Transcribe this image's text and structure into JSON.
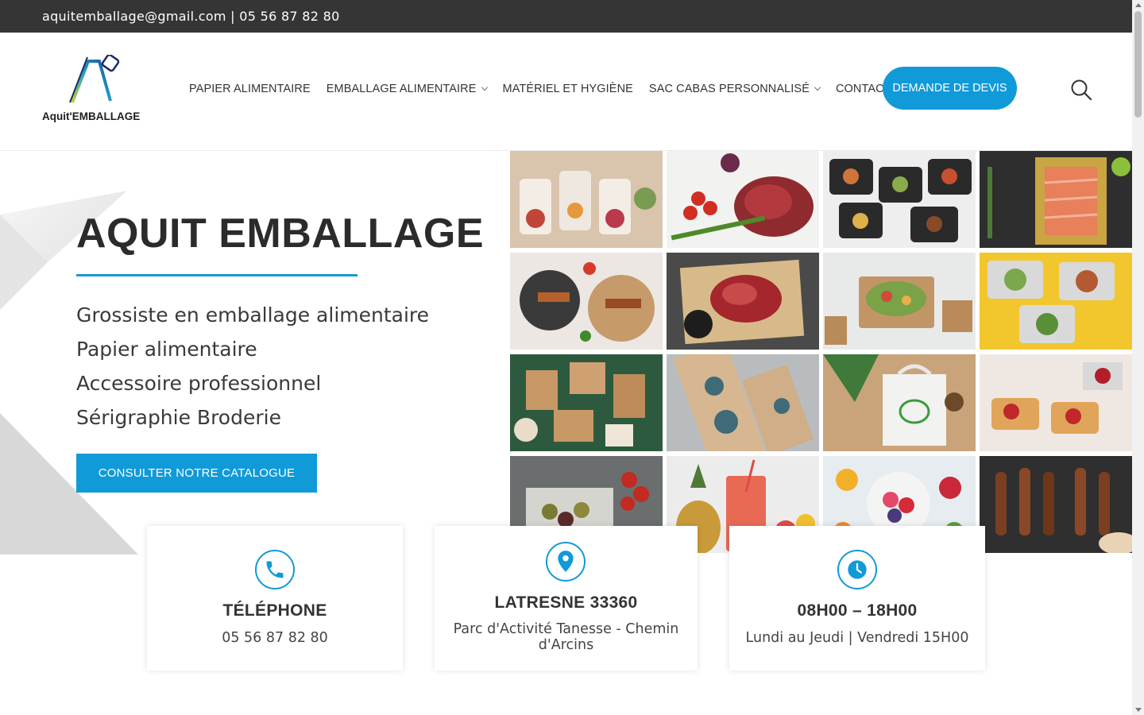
{
  "topbar": {
    "contact": "aquitemballage@gmail.com | 05 56 87 82 80"
  },
  "brand": {
    "logo_text": "Aquit'EMBALLAGE",
    "accent": "#109ad8",
    "topbar_bg": "#353535"
  },
  "nav": {
    "items": [
      {
        "label": "PAPIER ALIMENTAIRE",
        "has_dropdown": false
      },
      {
        "label": "EMBALLAGE ALIMENTAIRE",
        "has_dropdown": true
      },
      {
        "label": "MATÉRIEL ET HYGIÈNE",
        "has_dropdown": false
      },
      {
        "label": "SAC CABAS PERSONNALISÉ",
        "has_dropdown": true
      },
      {
        "label": "CONTACT",
        "has_dropdown": false
      }
    ],
    "cta": "DEMANDE DE DEVIS",
    "search_icon": "search-icon"
  },
  "hero": {
    "title": "AQUIT EMBALLAGE",
    "lines": [
      "Grossiste en emballage alimentaire",
      "Papier alimentaire",
      "Accessoire professionnel",
      "Sérigraphie Broderie"
    ],
    "button": "CONSULTER NOTRE CATALOGUE"
  },
  "cards": [
    {
      "icon": "phone-icon",
      "title": "TÉLÉPHONE",
      "text": "05 56 87 82 80"
    },
    {
      "icon": "location-pin-icon",
      "title": "LATRESNE 33360",
      "text": "Parc d'Activité Tanesse - Chemin d'Arcins"
    },
    {
      "icon": "clock-icon",
      "title": "08H00 – 18H00",
      "text": "Lundi au Jeudi | Vendredi 15H00"
    }
  ]
}
